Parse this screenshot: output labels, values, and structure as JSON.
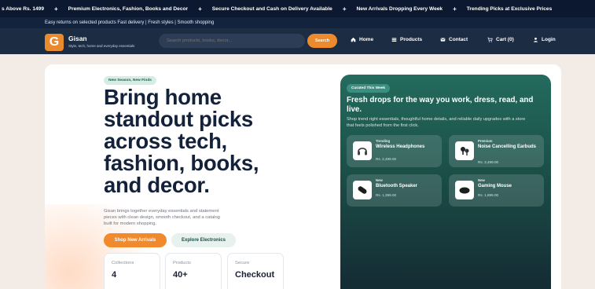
{
  "ticker": {
    "items": [
      "s Above Rs. 1499",
      "Premium Electronics, Fashion, Books and Decor",
      "Secure Checkout and Cash on Delivery Available",
      "New Arrivals Dropping Every Week",
      "Trending Picks at Exclusive Prices"
    ],
    "separator": "+"
  },
  "subbar": {
    "text": "Easy returns on selected products   Fast delivery | Fresh styles | Smooth shopping"
  },
  "brand": {
    "logo_letter": "G",
    "name": "Gisan",
    "tagline": "Style, tech, home and everyday essentials"
  },
  "search": {
    "placeholder": "Search products, books, decor...",
    "button": "Search"
  },
  "nav": {
    "home": "Home",
    "products": "Products",
    "contact": "Contact",
    "cart": "Cart (0)",
    "login": "Login"
  },
  "hero": {
    "eyebrow": "New Season, New Finds",
    "headline": "Bring home standout picks across tech, fashion, books, and decor.",
    "description": "Gisan brings together everyday essentials and statement pieces with clean design, smooth checkout, and a catalog built for modern shopping.",
    "primary_cta": "Shop New Arrivals",
    "secondary_cta": "Explore Electronics",
    "stats": [
      {
        "label": "Collections",
        "value": "4"
      },
      {
        "label": "Products",
        "value": "40+"
      },
      {
        "label": "Secure",
        "value": "Checkout"
      }
    ]
  },
  "panel": {
    "badge": "Curated This Week",
    "title": "Fresh drops for the way you work, dress, read, and live.",
    "description": "Shop trend right essentials, thoughtful home details, and reliable daily upgrades with a store that feels polished from the first click.",
    "products": [
      {
        "tag": "Trending",
        "name": "Wireless Headphones",
        "price": "Rs. 2,499.00",
        "icon": "headphones-icon"
      },
      {
        "tag": "Premium",
        "name": "Noise Cancelling Earbuds",
        "price": "Rs. 3,499.00",
        "icon": "earbuds-icon"
      },
      {
        "tag": "New",
        "name": "Bluetooth Speaker",
        "price": "Rs. 1,399.00",
        "icon": "speaker-icon"
      },
      {
        "tag": "New",
        "name": "Gaming Mouse",
        "price": "Rs. 1,899.00",
        "icon": "mouse-icon"
      }
    ]
  },
  "colors": {
    "accent": "#f08a2d",
    "navy": "#1c2c43",
    "teal": "#246b5e"
  }
}
